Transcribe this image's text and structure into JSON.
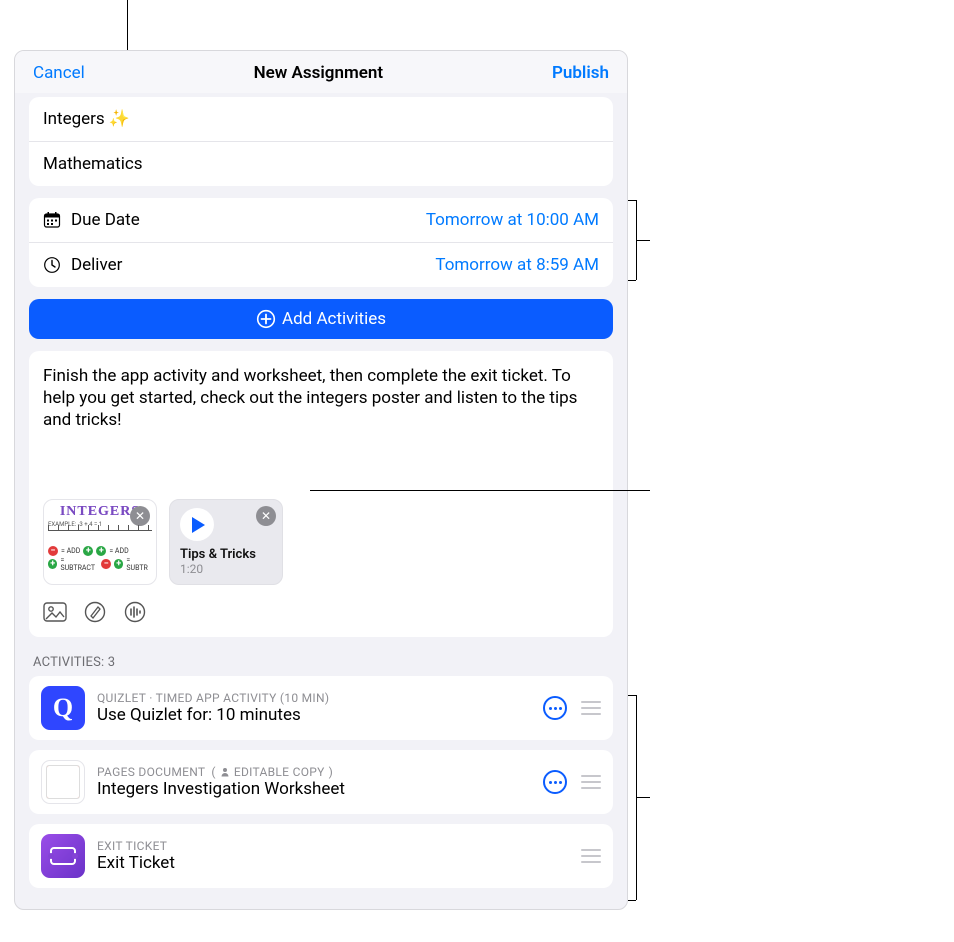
{
  "header": {
    "cancel": "Cancel",
    "title": "New Assignment",
    "publish": "Publish"
  },
  "assignment": {
    "name": "Integers ✨",
    "subject": "Mathematics"
  },
  "schedule": {
    "due_label": "Due Date",
    "due_value": "Tomorrow at 10:00 AM",
    "deliver_label": "Deliver",
    "deliver_value": "Tomorrow at 8:59 AM"
  },
  "add_activities_label": "Add Activities",
  "instructions": "Finish the app activity and worksheet, then complete the exit ticket. To help you get started, check out the integers poster and listen to the tips and tricks!",
  "attachments": [
    {
      "kind": "poster",
      "title": "INTEGERS"
    },
    {
      "kind": "audio",
      "title": "Tips & Tricks",
      "duration": "1:20"
    }
  ],
  "activities_header": "ACTIVITIES: 3",
  "activities": [
    {
      "icon": "quizlet",
      "meta": "QUIZLET · TIMED APP ACTIVITY (10 MIN)",
      "title": "Use Quizlet for: 10 minutes",
      "has_more": true
    },
    {
      "icon": "pages",
      "meta": "PAGES DOCUMENT",
      "badge_icon": "person",
      "badge_text": "EDITABLE COPY",
      "title": "Integers Investigation Worksheet",
      "has_more": true
    },
    {
      "icon": "ticket",
      "meta": "EXIT TICKET",
      "title": "Exit Ticket",
      "has_more": false
    }
  ]
}
